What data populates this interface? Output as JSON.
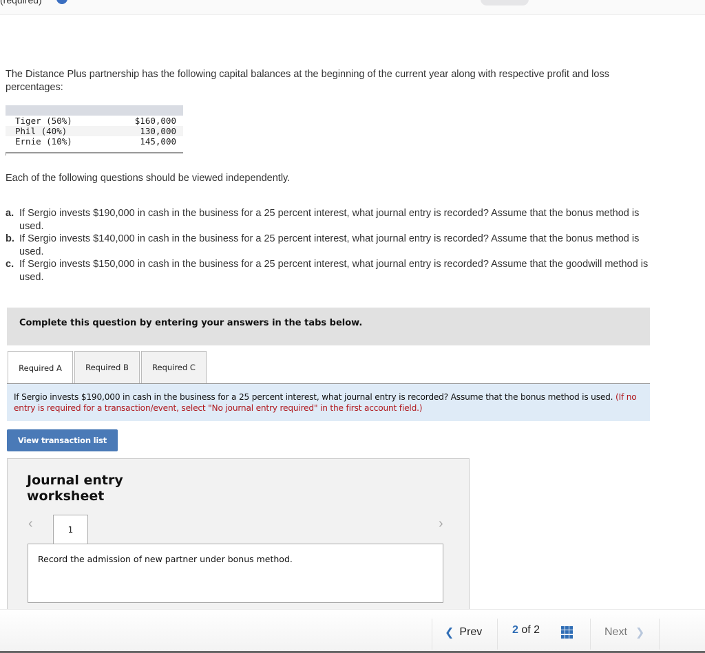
{
  "header": {
    "partial_label": "(required)",
    "info_icon": "info-icon"
  },
  "intro": "The Distance Plus partnership has the following capital balances at the beginning of the current year along with respective profit and loss percentages:",
  "capital_table": {
    "rows": [
      {
        "partner": "Tiger (50%)",
        "balance": "$160,000"
      },
      {
        "partner": "Phil (40%)",
        "balance": "130,000"
      },
      {
        "partner": "Ernie (10%)",
        "balance": "145,000"
      }
    ]
  },
  "independent_note": "Each of the following questions should be viewed independently.",
  "questions": [
    {
      "label": "a.",
      "text": "If Sergio invests $190,000 in cash in the business for a 25 percent interest, what journal entry is recorded? Assume that the bonus method is used."
    },
    {
      "label": "b.",
      "text": "If Sergio invests $140,000 in cash in the business for a 25 percent interest, what journal entry is recorded? Assume that the bonus method is used."
    },
    {
      "label": "c.",
      "text": "If Sergio invests $150,000 in cash in the business for a 25 percent interest, what journal entry is recorded? Assume that the goodwill method is used."
    }
  ],
  "complete_banner": "Complete this question by entering your answers in the tabs below.",
  "tabs": [
    {
      "label": "Required A",
      "active": true
    },
    {
      "label": "Required B",
      "active": false
    },
    {
      "label": "Required C",
      "active": false
    }
  ],
  "prompt": {
    "text": "If Sergio invests $190,000 in cash in the business for a 25 percent interest, what journal entry is recorded? Assume that the bonus method is used.",
    "note": "(If no entry is required for a transaction/event, select \"No journal entry required\" in the first account field.)"
  },
  "view_transaction_button": "View transaction list",
  "worksheet": {
    "title": "Journal entry worksheet",
    "page_tab": "1",
    "instruction": "Record the admission of new partner under bonus method."
  },
  "footer": {
    "prev_label": "Prev",
    "current_page": "2",
    "of_label": "of",
    "total_pages": "2",
    "next_label": "Next"
  },
  "colors": {
    "accent_blue": "#2f6db5",
    "button_blue": "#4a7ab7",
    "note_red": "#b0191e",
    "prompt_bg": "#dfebf7"
  }
}
